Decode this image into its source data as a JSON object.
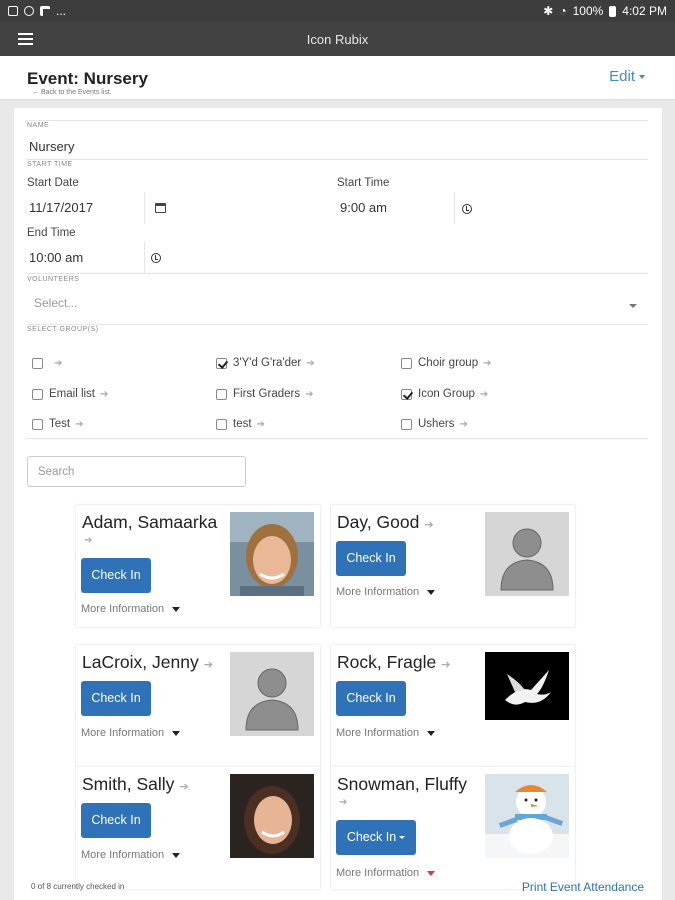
{
  "status_bar": {
    "left_extra": "...",
    "battery": "100%",
    "time": "4:02 PM"
  },
  "app": {
    "title": "Icon Rubix"
  },
  "header": {
    "event_title": "Event: Nursery",
    "back_link": "Back to the Events list.",
    "edit_label": "Edit"
  },
  "form": {
    "name_label": "NAME",
    "name_value": "Nursery",
    "start_time_label": "START TIME",
    "start_date_label": "Start Date",
    "start_date_value": "11/17/2017",
    "start_time_sub": "Start Time",
    "start_time_value": "9:00 am",
    "end_time_label": "End Time",
    "end_time_value": "10:00 am",
    "volunteers_label": "VOLUNTEERS",
    "volunteers_placeholder": "Select...",
    "groups_label": "SELECT GROUP(S)"
  },
  "groups": [
    {
      "label": "",
      "checked": false
    },
    {
      "label": "3'Y'd G'ra'der",
      "checked": true
    },
    {
      "label": "Choir group",
      "checked": false
    },
    {
      "label": "Email list",
      "checked": false
    },
    {
      "label": "First Graders",
      "checked": false
    },
    {
      "label": "Icon Group",
      "checked": true
    },
    {
      "label": "Test",
      "checked": false
    },
    {
      "label": "test",
      "checked": false
    },
    {
      "label": "Ushers",
      "checked": false
    }
  ],
  "search": {
    "placeholder": "Search"
  },
  "people": [
    {
      "name": "Adam, Samaarka",
      "photo": "woman-photo",
      "check_in": "Check In",
      "more": "More Information"
    },
    {
      "name": "Day, Good",
      "photo": "silhouette",
      "check_in": "Check In",
      "more": "More Information"
    },
    {
      "name": "LaCroix, Jenny",
      "photo": "silhouette",
      "check_in": "Check In",
      "more": "More Information"
    },
    {
      "name": "Rock, Fragle",
      "photo": "dove-photo",
      "check_in": "Check In",
      "more": "More Information"
    },
    {
      "name": "Smith, Sally",
      "photo": "woman-photo",
      "check_in": "Check In",
      "more": "More Information"
    },
    {
      "name": "Snowman, Fluffy",
      "photo": "snowman-photo",
      "check_in": "Check In",
      "more": "More Information"
    }
  ],
  "footer": {
    "count_text": "0 of 8 currently checked in",
    "print_label": "Print Event Attendance"
  },
  "colors": {
    "accent": "#2f72b8",
    "appbar": "#424242",
    "statusbar": "#3d3d3d"
  }
}
